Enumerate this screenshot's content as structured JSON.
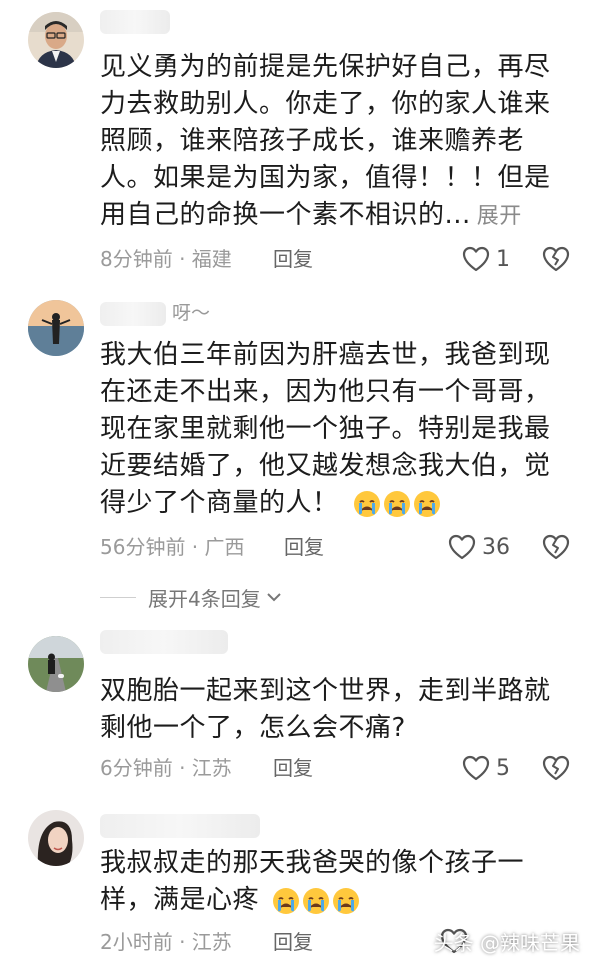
{
  "comments": [
    {
      "username": "",
      "text": "见义勇为的前提是先保护好自己，再尽力去救助别人。你走了，你的家人谁来照顾，谁来陪孩子成长，谁来赡养老人。如果是为国为家，值得！！！但是用自己的命换一个素不相识的...",
      "expand": "展开",
      "time": "8分钟前 · 福建",
      "reply": "回复",
      "likes": "1",
      "avatar_icon": "man-glasses-avatar"
    },
    {
      "username": "呀～",
      "text": "我大伯三年前因为肝癌去世，我爸到现在还走不出来，因为他只有一个哥哥，现在家里就剩他一个独子。特别是我最近要结婚了，他又越发想念我大伯，觉得少了个商量的人！",
      "time": "56分钟前 · 广西",
      "reply": "回复",
      "likes": "36",
      "avatar_icon": "lakeside-person-avatar"
    },
    {
      "username": "",
      "text": "双胞胎一起来到这个世界，走到半路就剩他一个了，怎么会不痛?",
      "time": "6分钟前 · 江苏",
      "reply": "回复",
      "likes": "5",
      "avatar_icon": "road-walker-avatar"
    },
    {
      "username": "",
      "text": "我叔叔走的那天我爸哭的像个孩子一样，满是心疼",
      "time": "2小时前 · 江苏",
      "reply": "回复",
      "likes": "",
      "avatar_icon": "woman-avatar"
    }
  ],
  "expand_replies": "展开4条回复",
  "watermark": "头条 @辣味芒果",
  "colors": {
    "meta": "#9a9a9a",
    "text": "#1c1c1c",
    "icon": "#555555"
  }
}
